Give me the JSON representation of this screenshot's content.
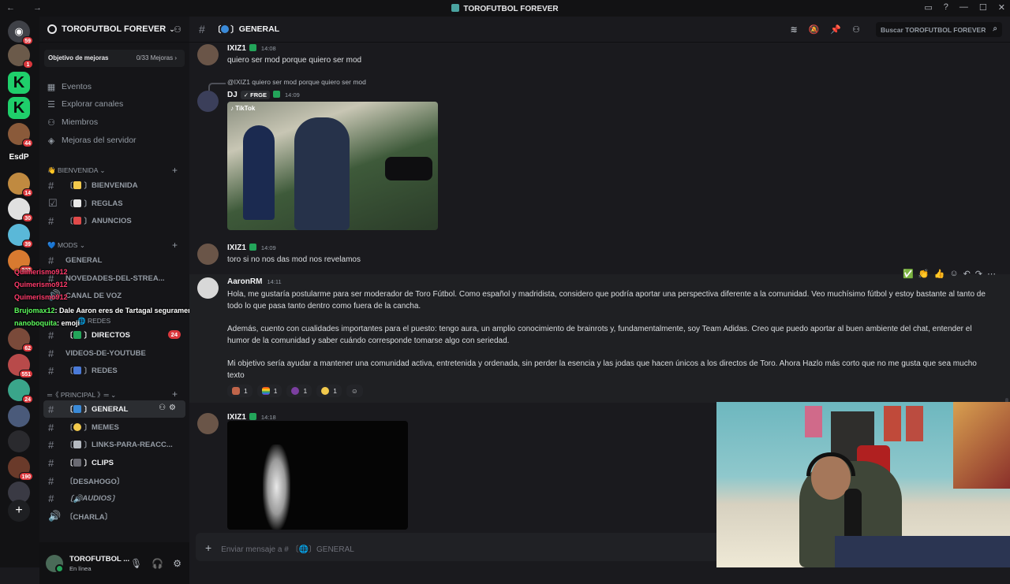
{
  "window": {
    "title": "TOROFUTBOL FOREVER",
    "controls": [
      "inbox-icon",
      "help-icon",
      "minimize",
      "maximize",
      "close"
    ]
  },
  "guilds": [
    {
      "name": "discord-home",
      "badge": "59"
    },
    {
      "name": "server-1",
      "badge": "1"
    },
    {
      "name": "kick-1",
      "badge": ""
    },
    {
      "name": "kick-2",
      "badge": ""
    },
    {
      "name": "server-4",
      "badge": "44"
    },
    {
      "name": "EsdP",
      "badge": ""
    },
    {
      "name": "server-6",
      "badge": "14"
    },
    {
      "name": "server-7",
      "badge": "30"
    },
    {
      "name": "server-8",
      "badge": "39"
    },
    {
      "name": "server-9",
      "badge": "203"
    },
    {
      "name": "server-10",
      "badge": "62"
    },
    {
      "name": "server-11",
      "badge": "551"
    },
    {
      "name": "server-12",
      "badge": "24"
    },
    {
      "name": "server-13",
      "badge": "190"
    }
  ],
  "sidebar": {
    "server_name": "TOROFUTBOL FOREVER",
    "goal": {
      "label": "Objetivo de mejoras",
      "value": "0/33 Mejoras"
    },
    "nav": [
      {
        "label": "Eventos",
        "icon": "calendar-icon"
      },
      {
        "label": "Explorar canales",
        "icon": "explore-icon"
      },
      {
        "label": "Miembros",
        "icon": "members-icon"
      },
      {
        "label": "Mejoras del servidor",
        "icon": "boost-icon"
      }
    ],
    "categories": {
      "bienvenida": "👋 BIENVENIDA",
      "mods": "💙 MODS",
      "redes": "🌐 REDES",
      "principal": "═《 PRINCIPAL 》═"
    },
    "channels": {
      "bienvenida": "BIENVENIDA",
      "reglas": "REGLAS",
      "anuncios": "ANUNCIOS",
      "general_mods": "GENERAL",
      "novedades": "NOVEDADES-DEL-STREA...",
      "canal_voz": "CANAL DE VOZ",
      "directos": "DIRECTOS",
      "directos_badge": "24",
      "videos": "VIDEOS-DE-YOUTUBE",
      "redes": "REDES",
      "general": "GENERAL",
      "memes": "MEMES",
      "links": "LINKS-PARA-REACC...",
      "clips": "CLIPS",
      "desahogo": "〔DESAHOGO〕",
      "audios": "AUDIOS",
      "charla": "〔CHARLA〕"
    },
    "user": {
      "name": "TOROFUTBOL ...",
      "status": "En línea"
    }
  },
  "overlay_chat": [
    {
      "user": "Quimerismo912",
      "text": ""
    },
    {
      "user": "Quimerismo912",
      "text": ""
    },
    {
      "user": "Quimerismo912",
      "text": ""
    },
    {
      "user": "Brujomax12",
      "text": ": Dale Aaron eres de Tartagal seguramente"
    },
    {
      "user": "nanoboquita",
      "text": ": emoji"
    }
  ],
  "channel_header": {
    "name": "GENERAL",
    "search_placeholder": "Buscar TOROFUTBOL FOREVER"
  },
  "messages": [
    {
      "user": "IXIZ1",
      "time": "14:08",
      "text": "quiero ser mod porque quiero ser mod"
    },
    {
      "user": "DJ",
      "tag": "FRGE",
      "time": "14:09",
      "reply": "@IXIZ1 quiero ser mod porque quiero ser mod",
      "media_label": "TikTok"
    },
    {
      "user": "IXIZ1",
      "time": "14:09",
      "text": "toro si no nos das mod nos revelamos"
    },
    {
      "user": "AaronRM",
      "time": "14:11",
      "p1": "Hola, me gustaría postularme para ser moderador de Toro Fútbol. Como español y madridista, considero que podría aportar una perspectiva diferente a la comunidad. Veo muchísimo fútbol y estoy bastante al tanto de todo lo que pasa tanto dentro como fuera de la cancha.",
      "p2": "Además, cuento con cualidades importantes para el puesto: tengo aura, un amplio conocimiento de brainrots y, fundamentalmente, soy Team Adidas. Creo que puedo aportar al buen ambiente del chat, entender el humor de la comunidad y saber cuándo corresponde tomarse algo con seriedad.",
      "p3": "Mi objetivo sería ayudar a mantener una comunidad activa, entretenida y ordenada, sin perder la esencia y las jodas que hacen únicos a los directos de Toro. Ahora Hazlo más corto que no me gusta que sea mucho texto",
      "reactions": [
        {
          "emoji": "clap-emoji",
          "count": "1"
        },
        {
          "emoji": "rainbow-flag-emoji",
          "count": "1"
        },
        {
          "emoji": "eggplant-emoji",
          "count": "1"
        },
        {
          "emoji": "crying-emoji",
          "count": "1"
        }
      ]
    },
    {
      "user": "IXIZ1",
      "time": "14:18"
    }
  ],
  "composer": {
    "placeholder": "Enviar mensaje a # 〔🌐〕GENERAL"
  },
  "colors": {
    "accent_green": "#23a55a",
    "badge_red": "#da373c",
    "bg": "#1a1a1e"
  }
}
